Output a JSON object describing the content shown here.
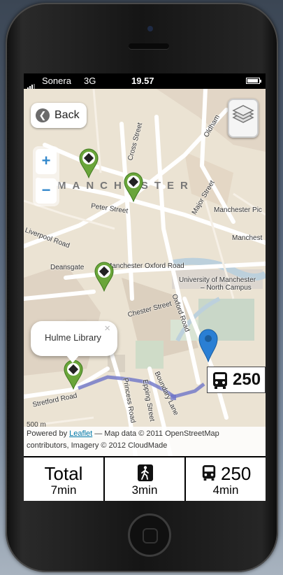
{
  "status_bar": {
    "carrier": "Sonera",
    "network": "3G",
    "time": "19.57"
  },
  "map": {
    "back_label": "Back",
    "zoom_in": "+",
    "zoom_out": "−",
    "city_label": "MANCHESTER",
    "popup": {
      "title": "Hulme Library",
      "close": "×"
    },
    "bus_badge": "250",
    "street_labels": {
      "oldham": "Oldham",
      "cross": "Cross Street",
      "peter": "Peter Street",
      "liverpool": "Liverpool Road",
      "deansgate": "Deansgate",
      "oxford": "Manchester Oxford Road",
      "university": "University of Manchester",
      "north_campus": "– North Campus",
      "chester": "Chester Street",
      "oxford_road": "Oxford Road",
      "princess": "Princess Road",
      "epping": "Epping Street",
      "boundary": "Boundary Lane",
      "stretford": "Stretford Road",
      "manchester_pic": "Manchester Pic",
      "manchest": "Manchest",
      "major": "Major Street"
    },
    "scale_label": "500 m",
    "attribution": {
      "powered": "Powered by ",
      "leaflet": "Leaflet",
      "rest": " — Map data © 2011 OpenStreetMap",
      "line2": "contributors, Imagery © 2012 CloudMade"
    }
  },
  "summary": {
    "total_label": "Total",
    "total_time": "7min",
    "walk_time": "3min",
    "bus_number": "250",
    "bus_time": "4min"
  },
  "icons": [
    "signal-icon",
    "battery-icon",
    "back-arrow-icon",
    "layers-icon",
    "place-pin-icon",
    "location-pin-icon",
    "walk-icon",
    "bus-icon"
  ],
  "colors": {
    "pin_green": "#6aa53a",
    "pin_blue": "#2a7fd4",
    "route": "#6e74c8",
    "link": "#0078a8"
  }
}
